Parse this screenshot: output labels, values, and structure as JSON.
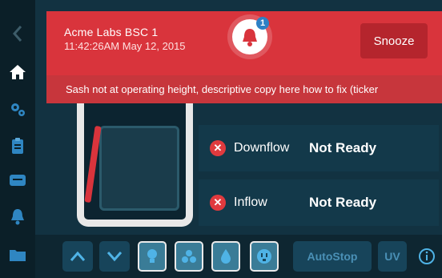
{
  "alert": {
    "title": "Acme Labs BSC 1",
    "time": "11:42:26AM  May 12, 2015",
    "badge_count": "1",
    "snooze_label": "Snooze",
    "message": "Sash not at operating height, descriptive copy here how to fix (ticker",
    "color": "#d9343c"
  },
  "sidebar": {
    "items": [
      {
        "icon": "back-chevron-icon"
      },
      {
        "icon": "home-icon"
      },
      {
        "icon": "gears-icon"
      },
      {
        "icon": "clipboard-icon"
      },
      {
        "icon": "message-icon"
      },
      {
        "icon": "bell-icon"
      },
      {
        "icon": "folder-icon"
      }
    ]
  },
  "status": {
    "rows": [
      {
        "label": "Downflow",
        "state": "Not Ready"
      },
      {
        "label": "Inflow",
        "state": "Not Ready"
      }
    ]
  },
  "toolbar": {
    "autostop_label": "AutoStop",
    "uv_label": "UV",
    "buttons": [
      "up-arrow-icon",
      "down-arrow-icon",
      "light-icon",
      "fan-icon",
      "water-drop-icon",
      "outlet-icon"
    ]
  }
}
